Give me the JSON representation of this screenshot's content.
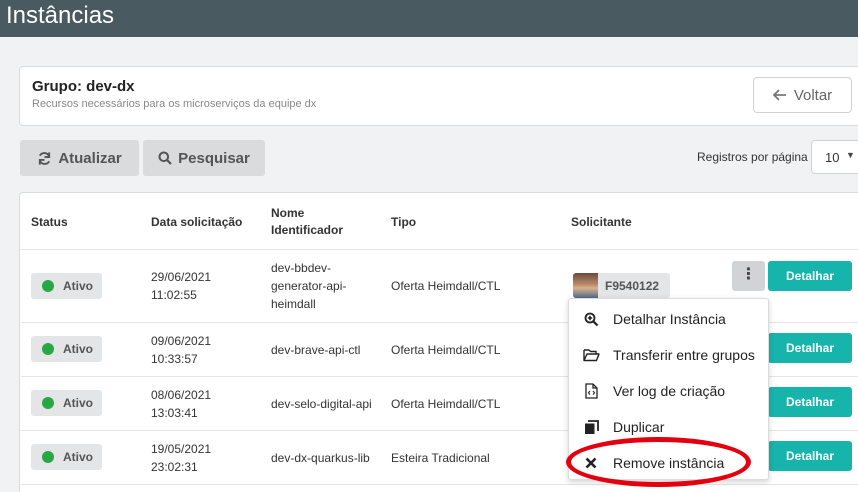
{
  "header": {
    "title": "Instâncias"
  },
  "group": {
    "title": "Grupo: dev-dx",
    "subtitle": "Recursos necessários para os microserviços da equipe dx",
    "back_label": "Voltar"
  },
  "toolbar": {
    "refresh_label": "Atualizar",
    "search_label": "Pesquisar",
    "per_page_label": "Registros por página",
    "per_page_value": "10"
  },
  "table": {
    "headers": {
      "status": "Status",
      "date": "Data solicitação",
      "name_l1": "Nome",
      "name_l2": "Identificador",
      "type": "Tipo",
      "requester": "Solicitante"
    },
    "rows": [
      {
        "status": "Ativo",
        "date": "29/06/2021",
        "time": "11:02:55",
        "name_l1": "dev-bbdev-",
        "name_l2": "generator-api-",
        "name_l3": "heimdall",
        "type": "Oferta Heimdall/CTL",
        "requester": "F9540122",
        "action": "Detalhar"
      },
      {
        "status": "Ativo",
        "date": "09/06/2021",
        "time": "10:33:57",
        "name": "dev-brave-api-ctl",
        "type": "Oferta Heimdall/CTL",
        "action": "Detalhar"
      },
      {
        "status": "Ativo",
        "date": "08/06/2021",
        "time": "13:03:41",
        "name": "dev-selo-digital-api",
        "type": "Oferta Heimdall/CTL",
        "action": "Detalhar"
      },
      {
        "status": "Ativo",
        "date": "19/05/2021",
        "time": "23:02:31",
        "name": "dev-dx-quarkus-lib",
        "type": "Esteira Tradicional",
        "action": "Detalhar"
      }
    ]
  },
  "menu": {
    "items": [
      {
        "label": "Detalhar Instância",
        "icon": "zoom-in-icon"
      },
      {
        "label": "Transferir entre grupos",
        "icon": "folder-open-icon"
      },
      {
        "label": "Ver log de criação",
        "icon": "file-code-icon"
      },
      {
        "label": "Duplicar",
        "icon": "copy-icon"
      },
      {
        "label": "Remove instância",
        "icon": "times-icon"
      }
    ]
  },
  "colors": {
    "topbar": "#4a5a61",
    "accent": "#17b4ac",
    "status_active": "#28a745",
    "highlight": "#e3000f"
  }
}
